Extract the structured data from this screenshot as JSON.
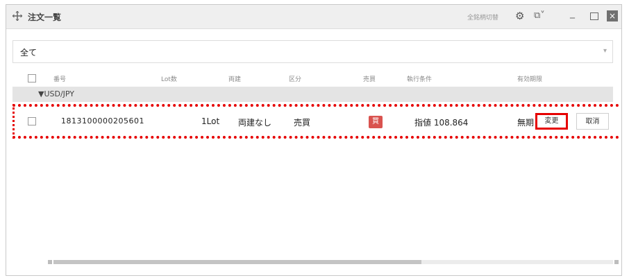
{
  "titlebar": {
    "title": "注文一覧",
    "switch_label": "全銘柄切替",
    "icons": [
      "move-icon",
      "gear-icon",
      "layout-icon",
      "minimize-icon",
      "maximize-icon",
      "close-icon"
    ]
  },
  "filter": {
    "value": "全て"
  },
  "columns": {
    "order_no": "番号",
    "lots": "Lot数",
    "settlement": "両建",
    "category": "区分",
    "side": "売買",
    "execution": "執行条件",
    "validity": "有効期限"
  },
  "group": {
    "label": "▼USD/JPY"
  },
  "order": {
    "order_no": "1813100000205601",
    "lots": "1Lot",
    "settlement": "両建なし",
    "category": "売買",
    "side_badge": "買",
    "execution": "指値 108.864",
    "validity": "無期",
    "change_label": "変更",
    "cancel_label": "取消"
  },
  "colors": {
    "buy_badge": "#d9534f",
    "highlight": "#e60000"
  }
}
